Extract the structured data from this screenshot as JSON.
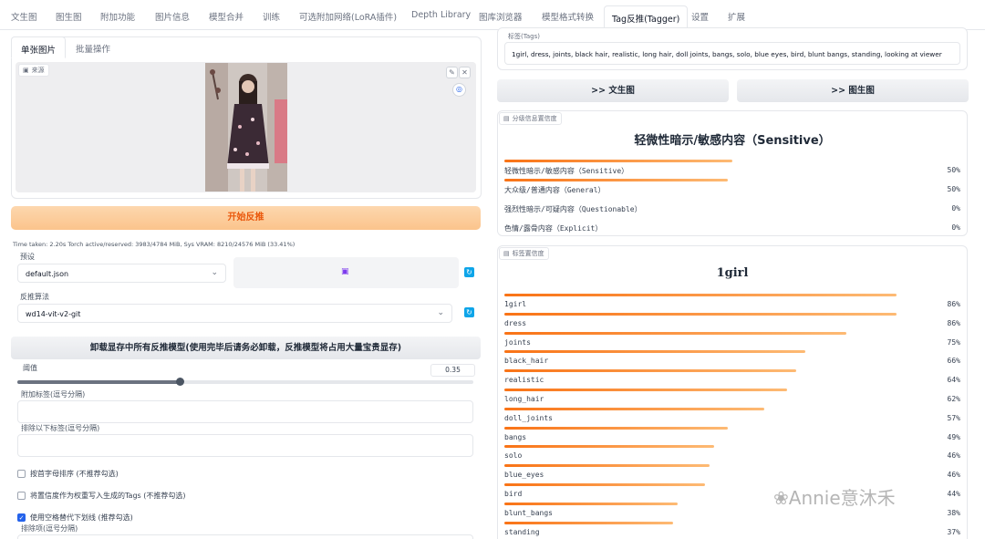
{
  "tabs": [
    "文生图",
    "图生图",
    "附加功能",
    "图片信息",
    "模型合并",
    "训练",
    "可选附加网络(LoRA插件)",
    "Depth Library",
    "图库浏览器",
    "模型格式转换",
    "Tag反推(Tagger)",
    "设置",
    "扩展"
  ],
  "left": {
    "subtabs": [
      "单张图片",
      "批量操作"
    ],
    "source_label": "来源",
    "start_button": "开始反推",
    "time_info": "Time taken: 2.20s  Torch active/reserved: 3983/4784 MiB, Sys VRAM: 8210/24576 MiB (33.41%)",
    "preset_label": "预设",
    "preset_value": "default.json",
    "algo_label": "反推算法",
    "algo_value": "wd14-vit-v2-git",
    "unload_button": "卸载显存中所有反推模型(使用完毕后请务必卸载，反推模型将占用大量宝贵显存)",
    "threshold_label": "阈值",
    "threshold_value": "0.35",
    "threshold_fraction": 0.35,
    "additional_tags_label": "附加标签(逗号分隔)",
    "exclude_tags_label": "排除以下标签(逗号分隔)",
    "checkboxes": [
      {
        "label": "按首字母排序 (不推荐勾选)",
        "checked": false
      },
      {
        "label": "将置信度作为权重写入生成的Tags (不推荐勾选)",
        "checked": false
      },
      {
        "label": "使用空格替代下划线 (推荐勾选)",
        "checked": true
      }
    ],
    "exclusion_label": "排除项(逗号分隔)"
  },
  "right": {
    "tags_label": "标签(Tags)",
    "tags_text": "1girl, dress, joints, black hair, realistic, long hair, doll joints, bangs, solo, blue eyes, bird, blunt bangs, standing, looking at viewer",
    "to_txt2img": ">> 文生图",
    "to_img2img": ">> 图生图",
    "rating_label": "分级信息置信度",
    "rating_title": "轻微性暗示/敏感内容（Sensitive）",
    "ratings": [
      {
        "name": "轻微性暗示/敏感内容（Sensitive）",
        "pct": "50%",
        "value": 0.5
      },
      {
        "name": "大众级/普通内容（General）",
        "pct": "50%",
        "value": 0.49
      },
      {
        "name": "强烈性暗示/可疑内容（Questionable）",
        "pct": "0%",
        "value": 0.0
      },
      {
        "name": "色情/露骨内容（Explicit）",
        "pct": "0%",
        "value": 0.0
      }
    ],
    "tag_conf_label": "标签置信度",
    "tag_conf_title": "1girl",
    "tag_conf": [
      {
        "name": "1girl",
        "pct": "86%",
        "value": 0.86
      },
      {
        "name": "dress",
        "pct": "86%",
        "value": 0.86
      },
      {
        "name": "joints",
        "pct": "75%",
        "value": 0.75
      },
      {
        "name": "black_hair",
        "pct": "66%",
        "value": 0.66
      },
      {
        "name": "realistic",
        "pct": "64%",
        "value": 0.64
      },
      {
        "name": "long_hair",
        "pct": "62%",
        "value": 0.62
      },
      {
        "name": "doll_joints",
        "pct": "57%",
        "value": 0.57
      },
      {
        "name": "bangs",
        "pct": "49%",
        "value": 0.49
      },
      {
        "name": "solo",
        "pct": "46%",
        "value": 0.46
      },
      {
        "name": "blue_eyes",
        "pct": "46%",
        "value": 0.45
      },
      {
        "name": "bird",
        "pct": "44%",
        "value": 0.44
      },
      {
        "name": "blunt_bangs",
        "pct": "38%",
        "value": 0.38
      },
      {
        "name": "standing",
        "pct": "37%",
        "value": 0.37
      }
    ]
  },
  "watermark": "Annie意沐禾"
}
